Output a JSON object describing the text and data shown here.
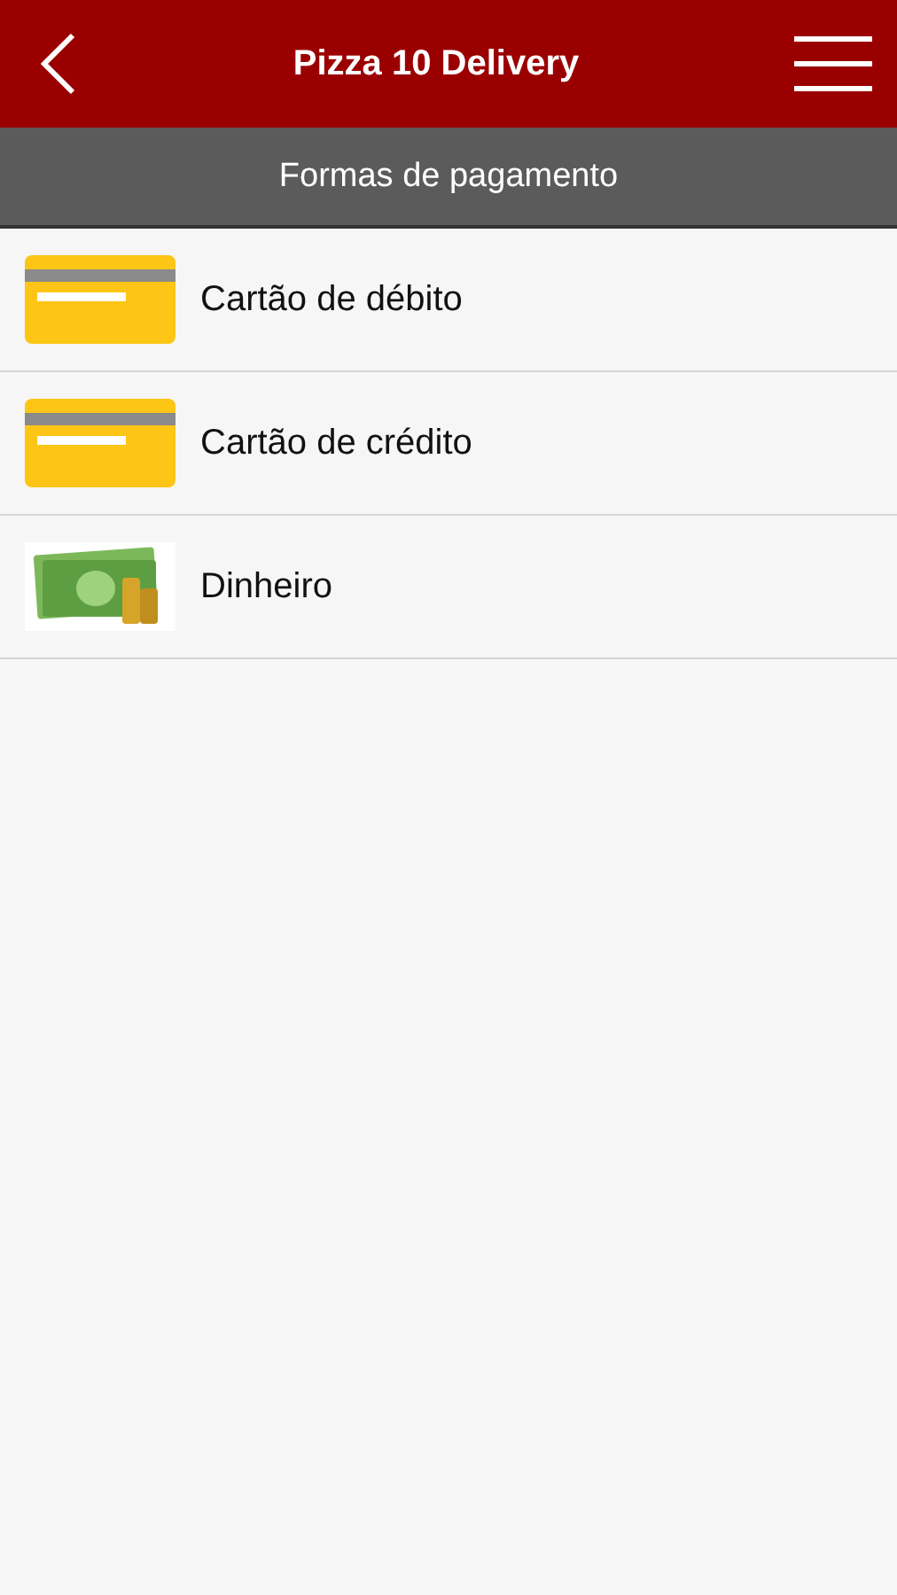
{
  "header": {
    "title": "Pizza 10 Delivery"
  },
  "section": {
    "title": "Formas de pagamento"
  },
  "payment_methods": [
    {
      "label": "Cartão de débito",
      "kind": "card"
    },
    {
      "label": "Cartão de crédito",
      "kind": "card"
    },
    {
      "label": "Dinheiro",
      "kind": "cash"
    }
  ]
}
